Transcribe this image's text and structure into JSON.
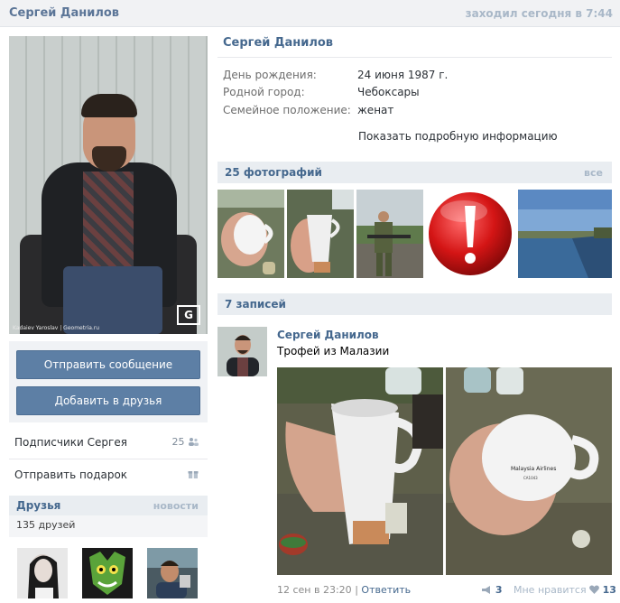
{
  "header": {
    "name": "Сергей Данилов",
    "status": "заходил сегодня в 7:44"
  },
  "avatar": {
    "credit": "Kadaiev Yaroslav | Geometria.ru",
    "watermark": "G"
  },
  "actions": {
    "send_message": "Отправить сообщение",
    "add_friend": "Добавить в друзья"
  },
  "left_links": [
    {
      "label": "Подписчики Сергея",
      "count": "25"
    },
    {
      "label": "Отправить подарок",
      "count": ""
    }
  ],
  "friends": {
    "title": "Друзья",
    "news": "новости",
    "count_text": "135 друзей"
  },
  "profile": {
    "name": "Сергей Данилов",
    "rows": [
      {
        "key": "День рождения:",
        "value": "24 июня 1987 г."
      },
      {
        "key": "Родной город:",
        "value": "Чебоксары"
      },
      {
        "key": "Семейное положение:",
        "value": "женат"
      }
    ],
    "more_link": "Показать подробную информацию"
  },
  "photos": {
    "title": "25 фотографий",
    "all_link": "все"
  },
  "wall": {
    "title": "7 записей"
  },
  "post": {
    "author": "Сергей Данилов",
    "text": "Трофей из Малазии",
    "date": "12 сен в 23:20",
    "separator": "|",
    "reply": "Ответить",
    "shares": "3",
    "like_label": "Мне нравится",
    "likes": "13",
    "mug_print_1": "Malaysia Airlines",
    "mug_print_2": "CA1043"
  },
  "colors": {
    "accent": "#45688e",
    "button": "#5d7fa5",
    "header_bg": "#f1f2f4",
    "section_bg": "#e9edf1"
  }
}
